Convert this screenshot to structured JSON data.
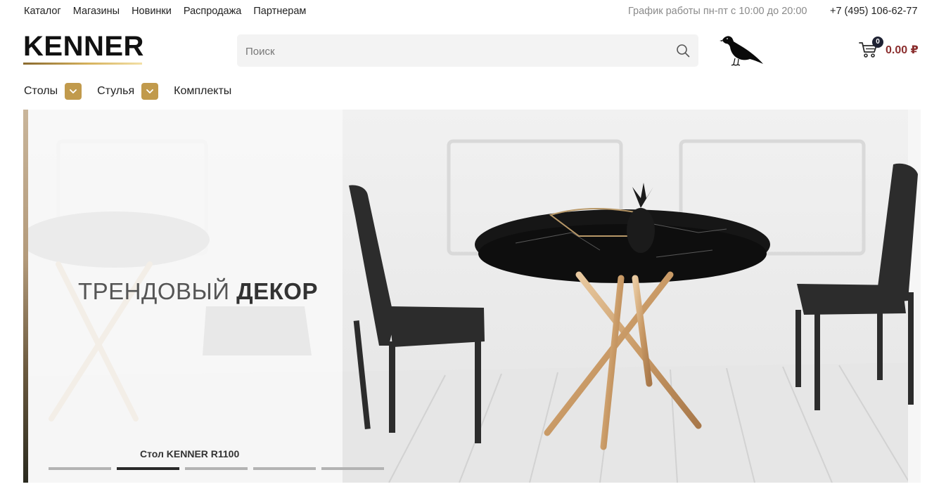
{
  "topbar": {
    "links": [
      "Каталог",
      "Магазины",
      "Новинки",
      "Распродажа",
      "Партнерам"
    ],
    "schedule": "График работы пн-пт с 10:00 до 20:00",
    "phone": "+7 (495) 106-62-77"
  },
  "header": {
    "logo": "KENNER",
    "search_placeholder": "Поиск",
    "cart": {
      "count": "0",
      "total": "0.00 ₽"
    }
  },
  "catnav": {
    "items": [
      {
        "label": "Столы",
        "has_dropdown": true
      },
      {
        "label": "Стулья",
        "has_dropdown": true
      },
      {
        "label": "Комплекты",
        "has_dropdown": false
      }
    ]
  },
  "banner": {
    "headline_light": "ТРЕНДОВЫЙ ",
    "headline_bold": "ДЕКОР",
    "caption": "Стол KENNER R1100",
    "slides_count": 5,
    "active_slide": 2
  },
  "colors": {
    "accent_gold": "#c19a4c",
    "price": "#8b2f2f",
    "badge": "#1f2233"
  }
}
